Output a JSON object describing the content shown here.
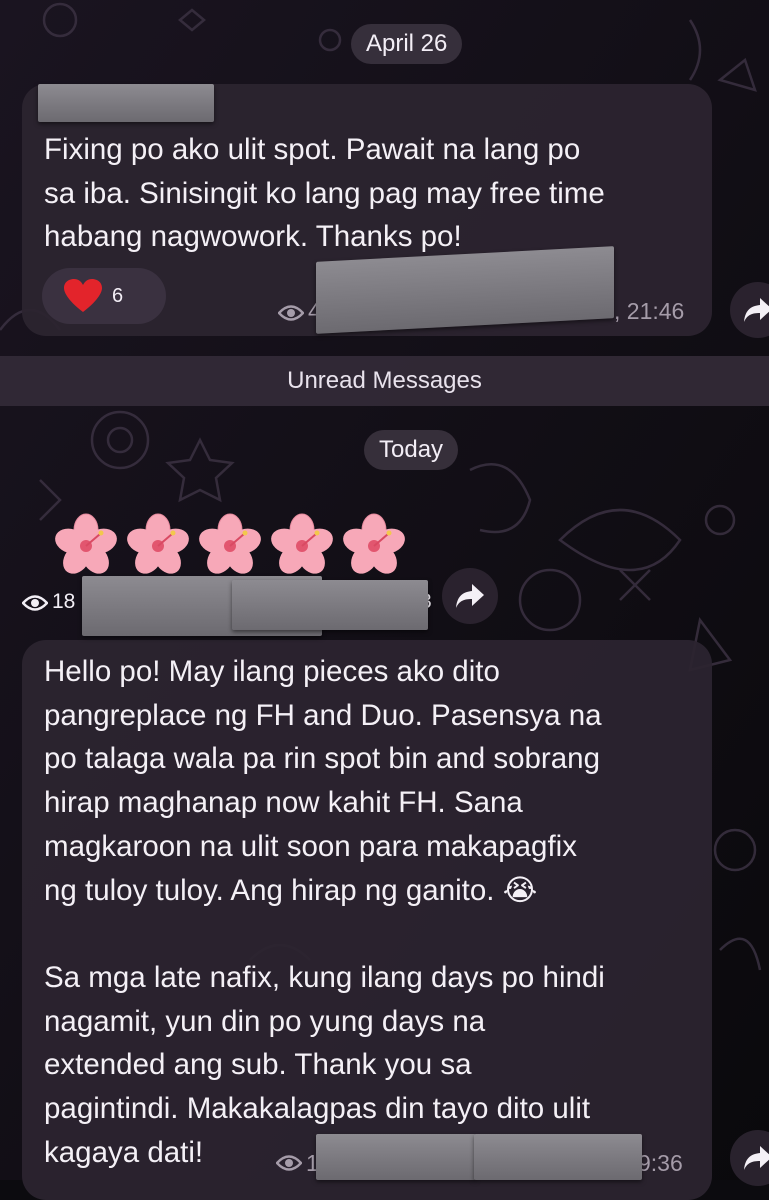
{
  "dates": {
    "first": "April 26",
    "second": "Today"
  },
  "message1": {
    "text": "Fixing po ako ulit spot. Pawait na lang po\nsa iba. Sinisingit ko lang pag may free time\nhabang nagwowork. Thanks po!",
    "reaction": {
      "emoji": "heart",
      "count": "6"
    },
    "views_partial": "4",
    "time_partial": ", 21:46"
  },
  "unread_label": "Unread Messages",
  "message2": {
    "emoji_name": "hibiscus",
    "emoji_count": 5,
    "views": "18",
    "meta_partial": "3"
  },
  "message3": {
    "text": "Hello po! May ilang pieces ako dito\npangreplace ng FH and Duo. Pasensya na\npo talaga wala pa rin spot bin and sobrang\nhirap maghanap now kahit FH. Sana\nmagkaroon na ulit soon para makapagfix\nng tuloy tuloy. Ang hirap ng ganito. 😭\n\nSa mga late nafix, kung ilang days po hindi\nnagamit, yun din po yung days na\nextended ang sub. Thank you sa\npagintindi. Makakalagpas din tayo dito ulit\nkagaya dati!",
    "views_partial": "1",
    "time_partial": "9:36"
  },
  "colors": {
    "background": "#0c0b0f",
    "bubble": "#2c2430",
    "meta": "#a59ca9",
    "reaction_heart": "#e3242b"
  }
}
